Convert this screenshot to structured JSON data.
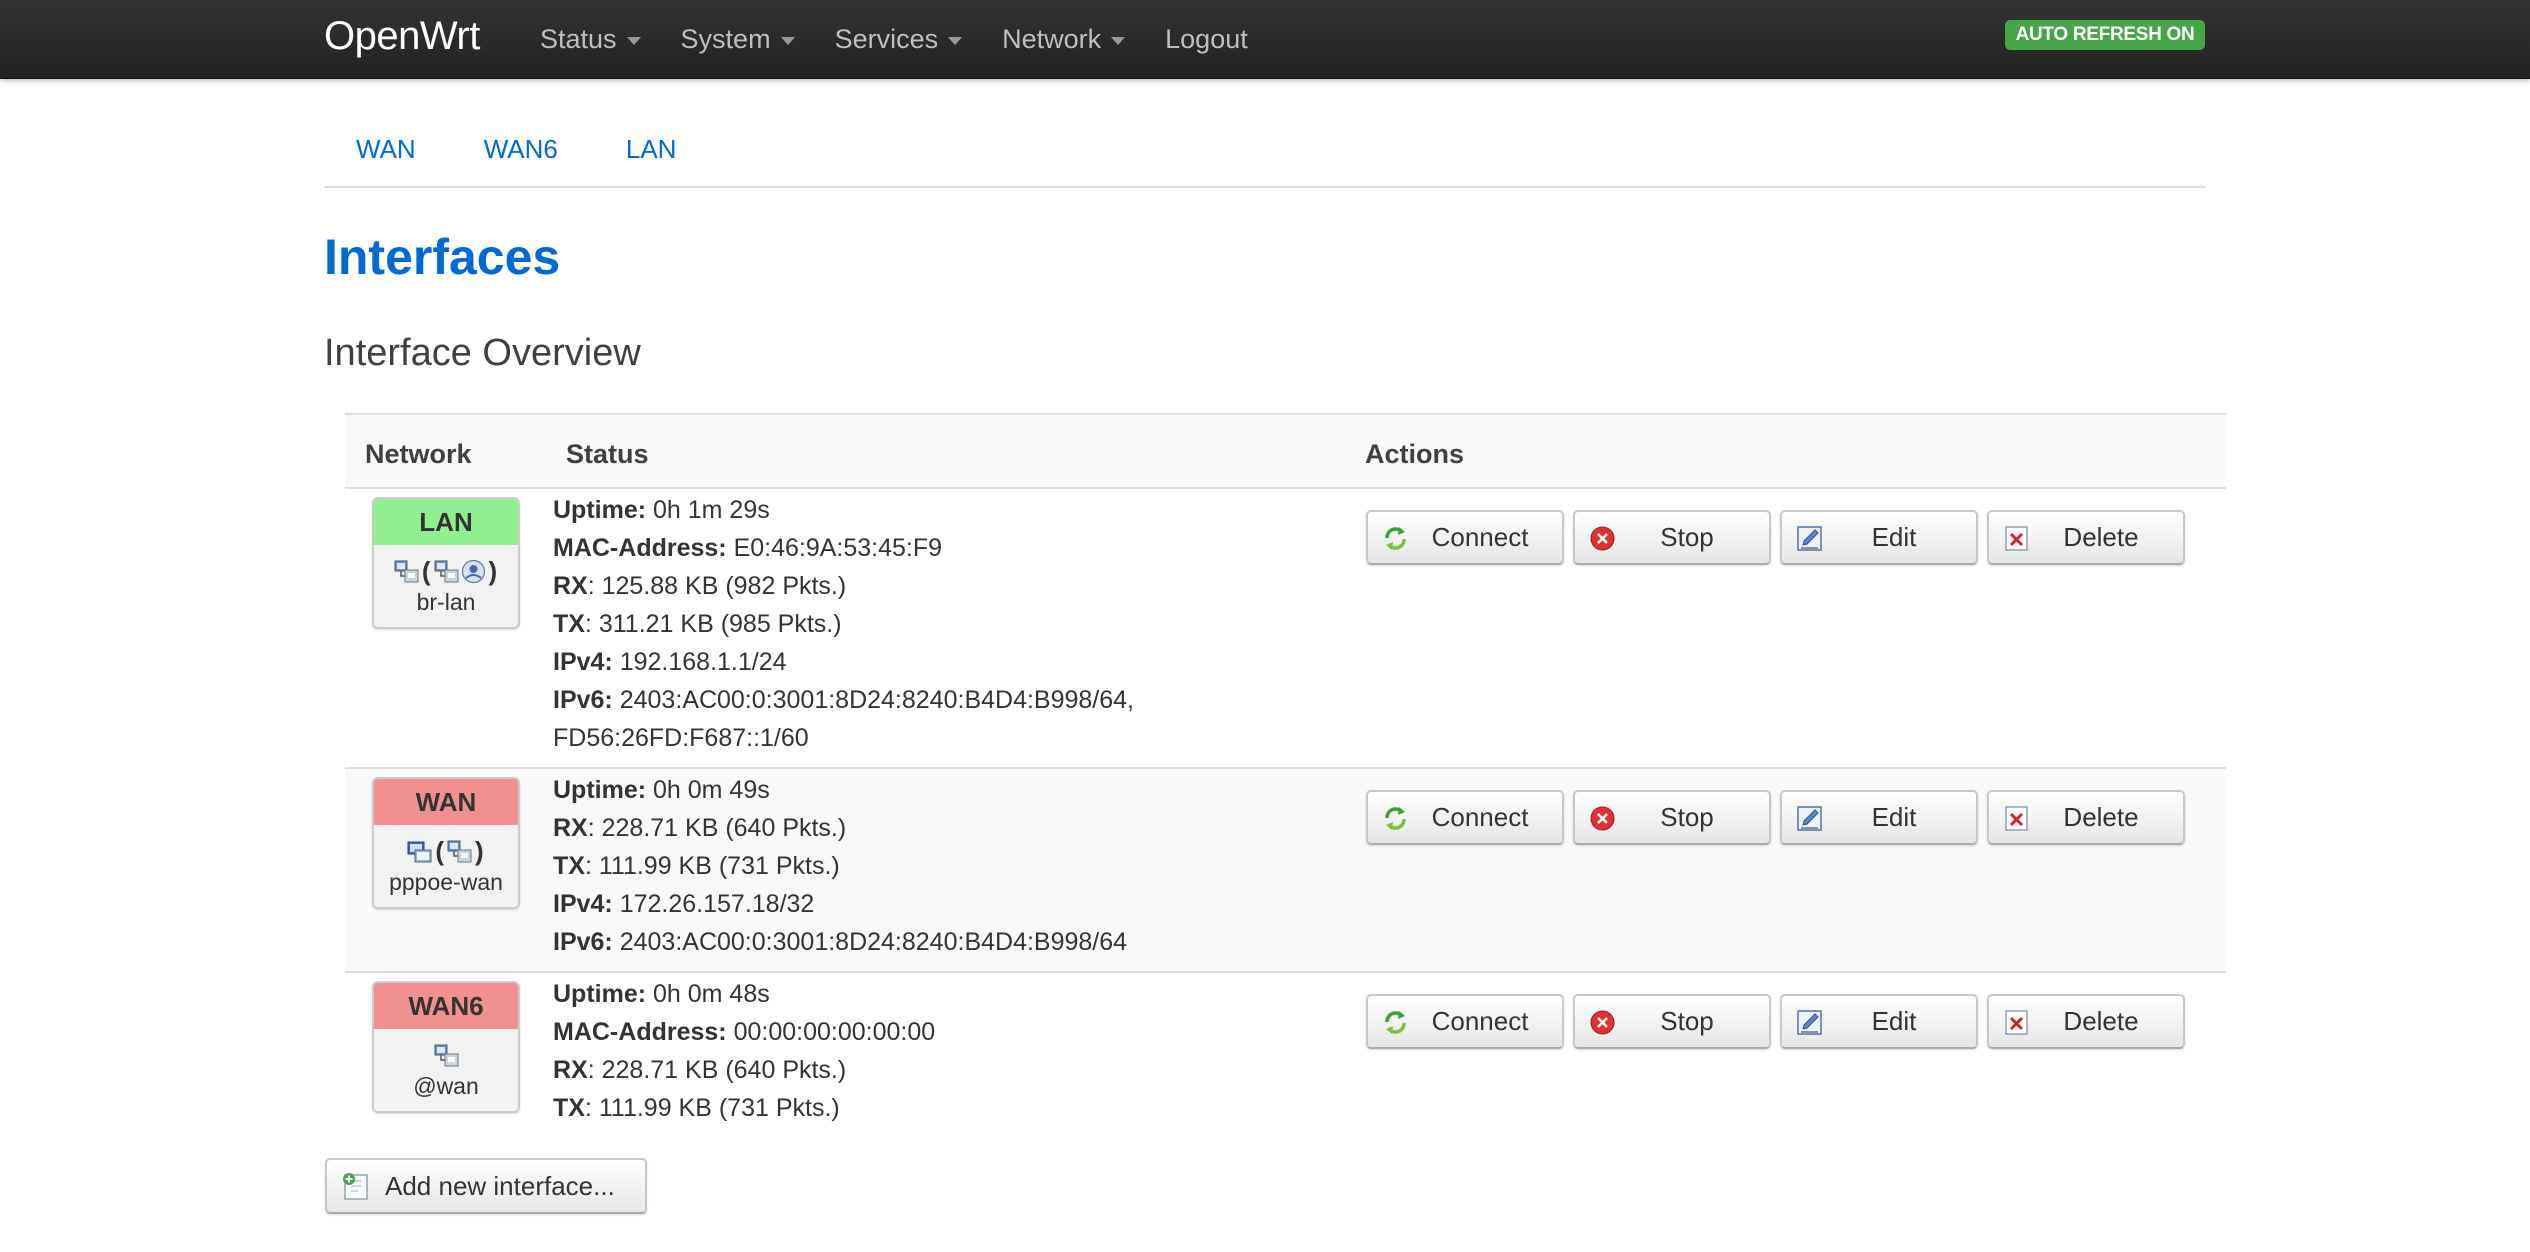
{
  "app": {
    "brand": "OpenWrt",
    "auto_refresh": "AUTO REFRESH ON"
  },
  "menu": [
    {
      "label": "Status",
      "dropdown": true
    },
    {
      "label": "System",
      "dropdown": true
    },
    {
      "label": "Services",
      "dropdown": true
    },
    {
      "label": "Network",
      "dropdown": true
    },
    {
      "label": "Logout",
      "dropdown": false
    }
  ],
  "tabs": [
    "WAN",
    "WAN6",
    "LAN"
  ],
  "page": {
    "title": "Interfaces",
    "section_title": "Interface Overview"
  },
  "table": {
    "headers": {
      "network": "Network",
      "status": "Status",
      "actions": "Actions"
    },
    "rows": [
      {
        "name": "LAN",
        "name_color": "#90f090",
        "device": "br-lan",
        "icons": [
          "ethernet-icon",
          "(",
          "ethernet-icon",
          "wireless-icon",
          ")"
        ],
        "status": [
          {
            "key": "Uptime:",
            "value": " 0h 1m 29s"
          },
          {
            "key": "MAC-Address:",
            "value": " E0:46:9A:53:45:F9"
          },
          {
            "key": "RX",
            "value": ": 125.88 KB (982 Pkts.)"
          },
          {
            "key": "TX",
            "value": ": 311.21 KB (985 Pkts.)"
          },
          {
            "key": "IPv4:",
            "value": " 192.168.1.1/24"
          },
          {
            "key": "IPv6:",
            "value": " 2403:AC00:0:3001:8D24:8240:B4D4:B998/64,"
          },
          {
            "key": "",
            "value": "FD56:26FD:F687::1/60"
          }
        ]
      },
      {
        "name": "WAN",
        "name_color": "#f09090",
        "device": "pppoe-wan",
        "icons": [
          "tunnel-icon",
          "(",
          "ethernet-icon",
          ")"
        ],
        "status": [
          {
            "key": "Uptime:",
            "value": " 0h 0m 49s"
          },
          {
            "key": "RX",
            "value": ": 228.71 KB (640 Pkts.)"
          },
          {
            "key": "TX",
            "value": ": 111.99 KB (731 Pkts.)"
          },
          {
            "key": "IPv4:",
            "value": " 172.26.157.18/32"
          },
          {
            "key": "IPv6:",
            "value": " 2403:AC00:0:3001:8D24:8240:B4D4:B998/64"
          }
        ]
      },
      {
        "name": "WAN6",
        "name_color": "#f09090",
        "device": "@wan",
        "icons": [
          "ethernet-icon"
        ],
        "status": [
          {
            "key": "Uptime:",
            "value": " 0h 0m 48s"
          },
          {
            "key": "MAC-Address:",
            "value": " 00:00:00:00:00:00"
          },
          {
            "key": "RX",
            "value": ": 228.71 KB (640 Pkts.)"
          },
          {
            "key": "TX",
            "value": ": 111.99 KB (731 Pkts.)"
          }
        ]
      }
    ],
    "actions": [
      {
        "label": "Connect",
        "icon": "reload-icon"
      },
      {
        "label": "Stop",
        "icon": "stop-icon"
      },
      {
        "label": "Edit",
        "icon": "edit-icon"
      },
      {
        "label": "Delete",
        "icon": "delete-icon"
      }
    ]
  },
  "add_button": {
    "label": "Add new interface...",
    "icon": "add-icon"
  }
}
